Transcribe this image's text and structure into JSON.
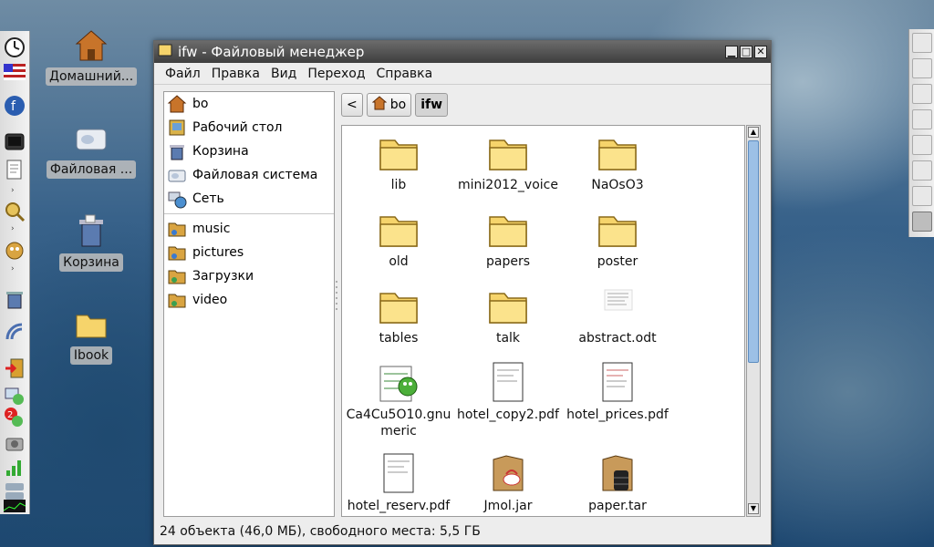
{
  "colors": {
    "titlebar": "#4a4a4a",
    "folder": "#f6d46b",
    "scroll_thumb": "#9cc0e6"
  },
  "desktop": {
    "icons": [
      {
        "label": "Домашний...",
        "icon": "home-icon"
      },
      {
        "label": "Файловая ...",
        "icon": "drive-icon"
      },
      {
        "label": "Корзина",
        "icon": "trash-icon"
      },
      {
        "label": "Ibook",
        "icon": "folder-icon"
      }
    ]
  },
  "window": {
    "title": "ifw - Файловый менеджер",
    "controls": {
      "minimize": "▁",
      "maximize": "□",
      "close": "✕"
    }
  },
  "menu": [
    "Файл",
    "Правка",
    "Вид",
    "Переход",
    "Справка"
  ],
  "sidebar": {
    "places": [
      {
        "label": "bo",
        "icon": "home-icon"
      },
      {
        "label": "Рабочий стол",
        "icon": "desktop-icon"
      },
      {
        "label": "Корзина",
        "icon": "trash-icon"
      },
      {
        "label": "Файловая система",
        "icon": "drive-icon"
      },
      {
        "label": "Сеть",
        "icon": "network-icon"
      }
    ],
    "bookmarks": [
      {
        "label": "music",
        "icon": "folder-bookmark-icon"
      },
      {
        "label": "pictures",
        "icon": "folder-bookmark-icon"
      },
      {
        "label": "Загрузки",
        "icon": "folder-bookmark-icon"
      },
      {
        "label": "video",
        "icon": "folder-bookmark-icon"
      }
    ]
  },
  "pathbar": {
    "back": "<",
    "crumbs": [
      "bo",
      "ifw"
    ]
  },
  "files": [
    {
      "name": "lib",
      "type": "folder"
    },
    {
      "name": "mini2012_voice",
      "type": "folder"
    },
    {
      "name": "NaOsO3",
      "type": "folder"
    },
    {
      "name": "old",
      "type": "folder"
    },
    {
      "name": "papers",
      "type": "folder"
    },
    {
      "name": "poster",
      "type": "folder"
    },
    {
      "name": "tables",
      "type": "folder"
    },
    {
      "name": "talk",
      "type": "folder"
    },
    {
      "name": "abstract.odt",
      "type": "document"
    },
    {
      "name": "Ca4Cu5O10.gnumeric",
      "type": "gnumeric"
    },
    {
      "name": "hotel_copy2.pdf",
      "type": "pdf"
    },
    {
      "name": "hotel_prices.pdf",
      "type": "pdf"
    },
    {
      "name": "hotel_reserv.pdf",
      "type": "pdf"
    },
    {
      "name": "Jmol.jar",
      "type": "jar"
    },
    {
      "name": "paper.tar",
      "type": "tar"
    }
  ],
  "status": "24 объекта (46,0 МБ), свободного места: 5,5 ГБ"
}
